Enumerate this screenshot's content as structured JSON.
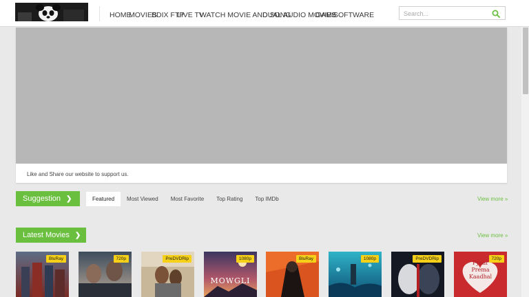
{
  "header": {
    "nav": [
      "HOME",
      "MOVIES",
      "BDIX FTP",
      "LIVE TV",
      "WATCH MOVIE AND SONG",
      "DUAL AUDIO MOVIES",
      "GAME",
      "SOFTWARE"
    ],
    "search_placeholder": "Search..."
  },
  "banner": {
    "text": "Like and Share our website to support us."
  },
  "suggestion": {
    "button_label": "Suggestion",
    "tabs": [
      "Featured",
      "Most Viewed",
      "Most Favorite",
      "Top Rating",
      "Top IMDb"
    ],
    "view_more": "View more »"
  },
  "latest": {
    "button_label": "Latest Movies",
    "view_more": "View more »",
    "movies": [
      {
        "badge": "BluRay"
      },
      {
        "badge": "720p"
      },
      {
        "badge": "PreDVDRip"
      },
      {
        "badge": "1080p",
        "title": "MOWGLI"
      },
      {
        "badge": "BluRay"
      },
      {
        "badge": "1080p"
      },
      {
        "badge": "PreDVDRip"
      },
      {
        "badge": "720p",
        "title_lines": [
          "Pyaar",
          "Prema",
          "Kaadhal"
        ]
      }
    ]
  },
  "colors": {
    "accent_green": "#6abf3f",
    "badge_yellow": "#f7d117",
    "banner_gray": "#b7b7b7",
    "page_bg": "#e9e9e9"
  },
  "icons": {
    "search": "search-icon",
    "chevron": "chevron-right-icon"
  }
}
